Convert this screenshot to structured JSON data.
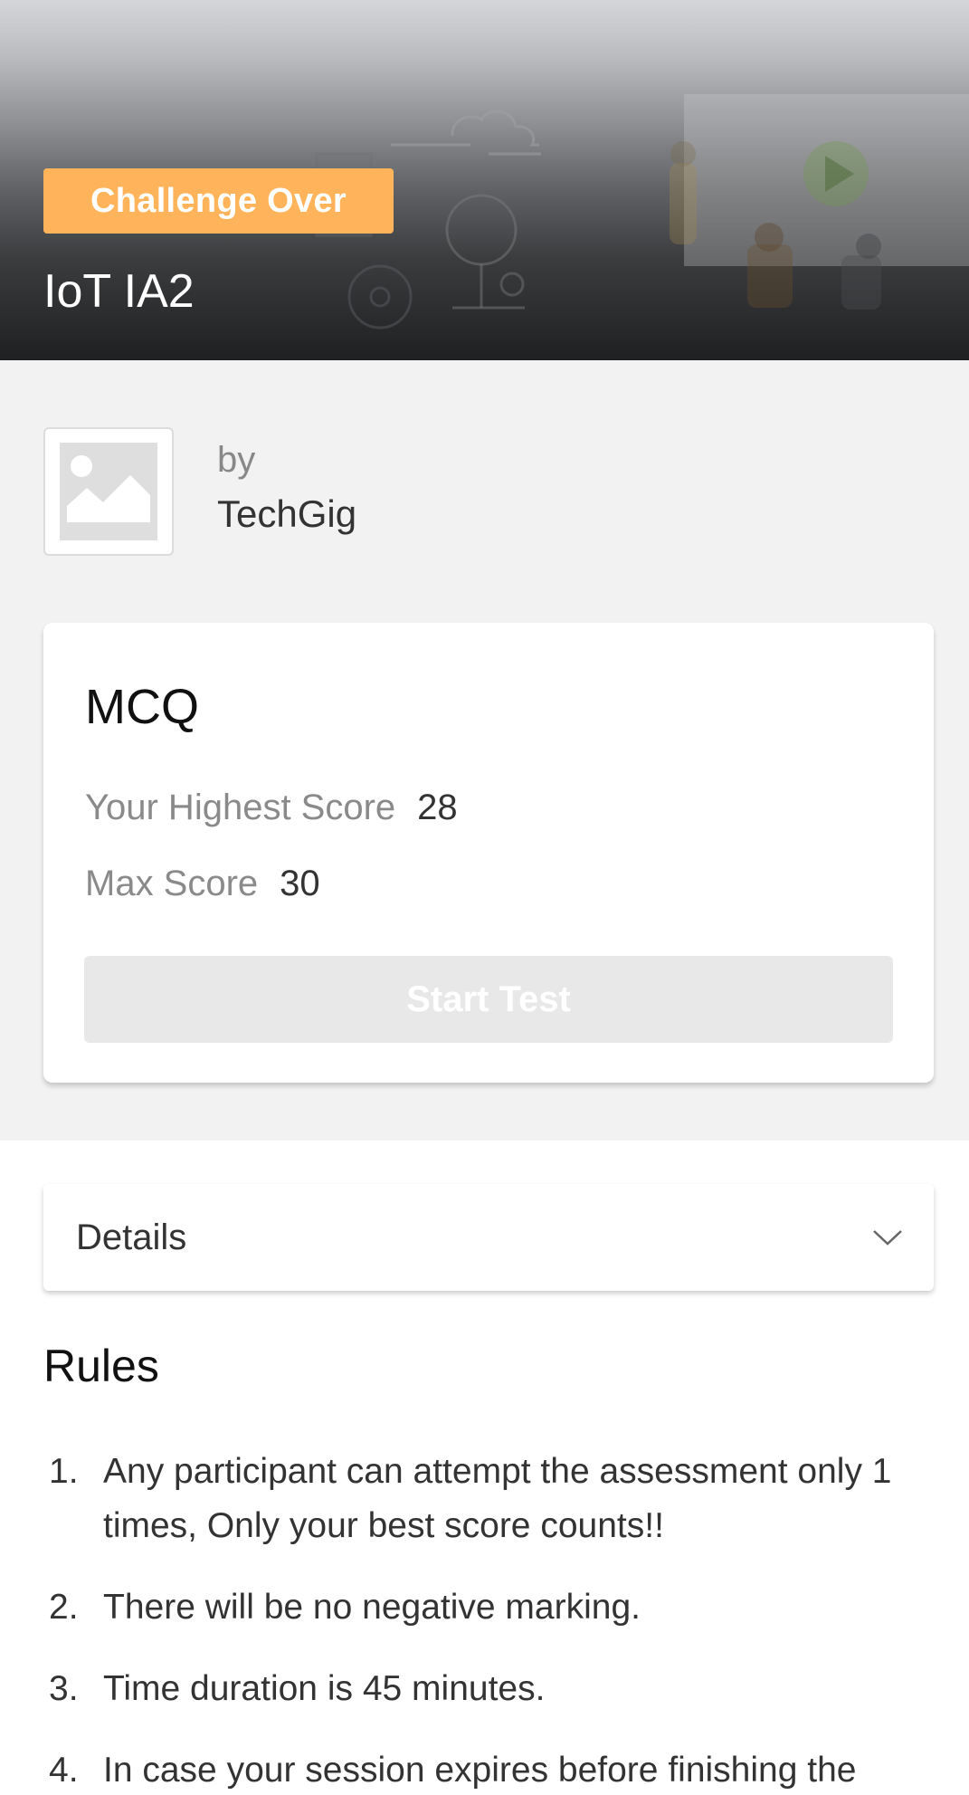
{
  "header": {
    "status_badge": "Challenge Over",
    "title": "IoT IA2"
  },
  "organizer": {
    "by_label": "by",
    "name": "TechGig",
    "logo_icon": "image-placeholder-icon"
  },
  "mcq_card": {
    "title": "MCQ",
    "highest_score_label": "Your Highest Score",
    "highest_score_value": "28",
    "max_score_label": "Max Score",
    "max_score_value": "30",
    "start_button_label": "Start Test"
  },
  "details": {
    "label": "Details",
    "icon": "chevron-down-icon"
  },
  "rules": {
    "title": "Rules",
    "items": [
      {
        "num": "1.",
        "text": "Any participant can attempt the assessment only 1 times, Only your best score counts!!"
      },
      {
        "num": "2.",
        "text": "There will be no negative marking."
      },
      {
        "num": "3.",
        "text": "Time duration is 45 minutes."
      },
      {
        "num": "4.",
        "text": "In case your session expires before finishing the"
      }
    ]
  },
  "colors": {
    "badge": "#ffb35b",
    "page_bg": "#f2f2f2",
    "button_disabled": "#e8e8e8"
  }
}
